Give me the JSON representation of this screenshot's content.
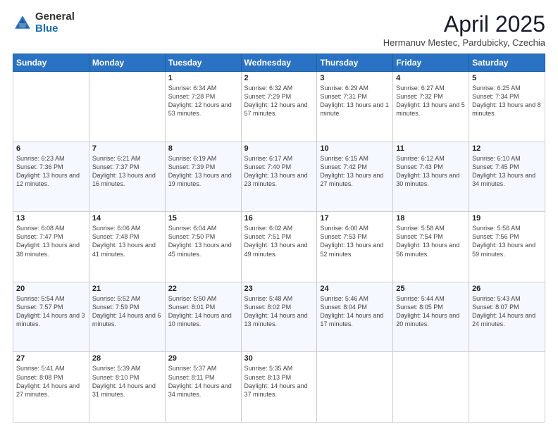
{
  "logo": {
    "general": "General",
    "blue": "Blue"
  },
  "header": {
    "month": "April 2025",
    "location": "Hermanuv Mestec, Pardubicky, Czechia"
  },
  "weekdays": [
    "Sunday",
    "Monday",
    "Tuesday",
    "Wednesday",
    "Thursday",
    "Friday",
    "Saturday"
  ],
  "weeks": [
    [
      {
        "day": "",
        "sunrise": "",
        "sunset": "",
        "daylight": ""
      },
      {
        "day": "",
        "sunrise": "",
        "sunset": "",
        "daylight": ""
      },
      {
        "day": "1",
        "sunrise": "Sunrise: 6:34 AM",
        "sunset": "Sunset: 7:28 PM",
        "daylight": "Daylight: 12 hours and 53 minutes."
      },
      {
        "day": "2",
        "sunrise": "Sunrise: 6:32 AM",
        "sunset": "Sunset: 7:29 PM",
        "daylight": "Daylight: 12 hours and 57 minutes."
      },
      {
        "day": "3",
        "sunrise": "Sunrise: 6:29 AM",
        "sunset": "Sunset: 7:31 PM",
        "daylight": "Daylight: 13 hours and 1 minute."
      },
      {
        "day": "4",
        "sunrise": "Sunrise: 6:27 AM",
        "sunset": "Sunset: 7:32 PM",
        "daylight": "Daylight: 13 hours and 5 minutes."
      },
      {
        "day": "5",
        "sunrise": "Sunrise: 6:25 AM",
        "sunset": "Sunset: 7:34 PM",
        "daylight": "Daylight: 13 hours and 8 minutes."
      }
    ],
    [
      {
        "day": "6",
        "sunrise": "Sunrise: 6:23 AM",
        "sunset": "Sunset: 7:36 PM",
        "daylight": "Daylight: 13 hours and 12 minutes."
      },
      {
        "day": "7",
        "sunrise": "Sunrise: 6:21 AM",
        "sunset": "Sunset: 7:37 PM",
        "daylight": "Daylight: 13 hours and 16 minutes."
      },
      {
        "day": "8",
        "sunrise": "Sunrise: 6:19 AM",
        "sunset": "Sunset: 7:39 PM",
        "daylight": "Daylight: 13 hours and 19 minutes."
      },
      {
        "day": "9",
        "sunrise": "Sunrise: 6:17 AM",
        "sunset": "Sunset: 7:40 PM",
        "daylight": "Daylight: 13 hours and 23 minutes."
      },
      {
        "day": "10",
        "sunrise": "Sunrise: 6:15 AM",
        "sunset": "Sunset: 7:42 PM",
        "daylight": "Daylight: 13 hours and 27 minutes."
      },
      {
        "day": "11",
        "sunrise": "Sunrise: 6:12 AM",
        "sunset": "Sunset: 7:43 PM",
        "daylight": "Daylight: 13 hours and 30 minutes."
      },
      {
        "day": "12",
        "sunrise": "Sunrise: 6:10 AM",
        "sunset": "Sunset: 7:45 PM",
        "daylight": "Daylight: 13 hours and 34 minutes."
      }
    ],
    [
      {
        "day": "13",
        "sunrise": "Sunrise: 6:08 AM",
        "sunset": "Sunset: 7:47 PM",
        "daylight": "Daylight: 13 hours and 38 minutes."
      },
      {
        "day": "14",
        "sunrise": "Sunrise: 6:06 AM",
        "sunset": "Sunset: 7:48 PM",
        "daylight": "Daylight: 13 hours and 41 minutes."
      },
      {
        "day": "15",
        "sunrise": "Sunrise: 6:04 AM",
        "sunset": "Sunset: 7:50 PM",
        "daylight": "Daylight: 13 hours and 45 minutes."
      },
      {
        "day": "16",
        "sunrise": "Sunrise: 6:02 AM",
        "sunset": "Sunset: 7:51 PM",
        "daylight": "Daylight: 13 hours and 49 minutes."
      },
      {
        "day": "17",
        "sunrise": "Sunrise: 6:00 AM",
        "sunset": "Sunset: 7:53 PM",
        "daylight": "Daylight: 13 hours and 52 minutes."
      },
      {
        "day": "18",
        "sunrise": "Sunrise: 5:58 AM",
        "sunset": "Sunset: 7:54 PM",
        "daylight": "Daylight: 13 hours and 56 minutes."
      },
      {
        "day": "19",
        "sunrise": "Sunrise: 5:56 AM",
        "sunset": "Sunset: 7:56 PM",
        "daylight": "Daylight: 13 hours and 59 minutes."
      }
    ],
    [
      {
        "day": "20",
        "sunrise": "Sunrise: 5:54 AM",
        "sunset": "Sunset: 7:57 PM",
        "daylight": "Daylight: 14 hours and 3 minutes."
      },
      {
        "day": "21",
        "sunrise": "Sunrise: 5:52 AM",
        "sunset": "Sunset: 7:59 PM",
        "daylight": "Daylight: 14 hours and 6 minutes."
      },
      {
        "day": "22",
        "sunrise": "Sunrise: 5:50 AM",
        "sunset": "Sunset: 8:01 PM",
        "daylight": "Daylight: 14 hours and 10 minutes."
      },
      {
        "day": "23",
        "sunrise": "Sunrise: 5:48 AM",
        "sunset": "Sunset: 8:02 PM",
        "daylight": "Daylight: 14 hours and 13 minutes."
      },
      {
        "day": "24",
        "sunrise": "Sunrise: 5:46 AM",
        "sunset": "Sunset: 8:04 PM",
        "daylight": "Daylight: 14 hours and 17 minutes."
      },
      {
        "day": "25",
        "sunrise": "Sunrise: 5:44 AM",
        "sunset": "Sunset: 8:05 PM",
        "daylight": "Daylight: 14 hours and 20 minutes."
      },
      {
        "day": "26",
        "sunrise": "Sunrise: 5:43 AM",
        "sunset": "Sunset: 8:07 PM",
        "daylight": "Daylight: 14 hours and 24 minutes."
      }
    ],
    [
      {
        "day": "27",
        "sunrise": "Sunrise: 5:41 AM",
        "sunset": "Sunset: 8:08 PM",
        "daylight": "Daylight: 14 hours and 27 minutes."
      },
      {
        "day": "28",
        "sunrise": "Sunrise: 5:39 AM",
        "sunset": "Sunset: 8:10 PM",
        "daylight": "Daylight: 14 hours and 31 minutes."
      },
      {
        "day": "29",
        "sunrise": "Sunrise: 5:37 AM",
        "sunset": "Sunset: 8:11 PM",
        "daylight": "Daylight: 14 hours and 34 minutes."
      },
      {
        "day": "30",
        "sunrise": "Sunrise: 5:35 AM",
        "sunset": "Sunset: 8:13 PM",
        "daylight": "Daylight: 14 hours and 37 minutes."
      },
      {
        "day": "",
        "sunrise": "",
        "sunset": "",
        "daylight": ""
      },
      {
        "day": "",
        "sunrise": "",
        "sunset": "",
        "daylight": ""
      },
      {
        "day": "",
        "sunrise": "",
        "sunset": "",
        "daylight": ""
      }
    ]
  ]
}
